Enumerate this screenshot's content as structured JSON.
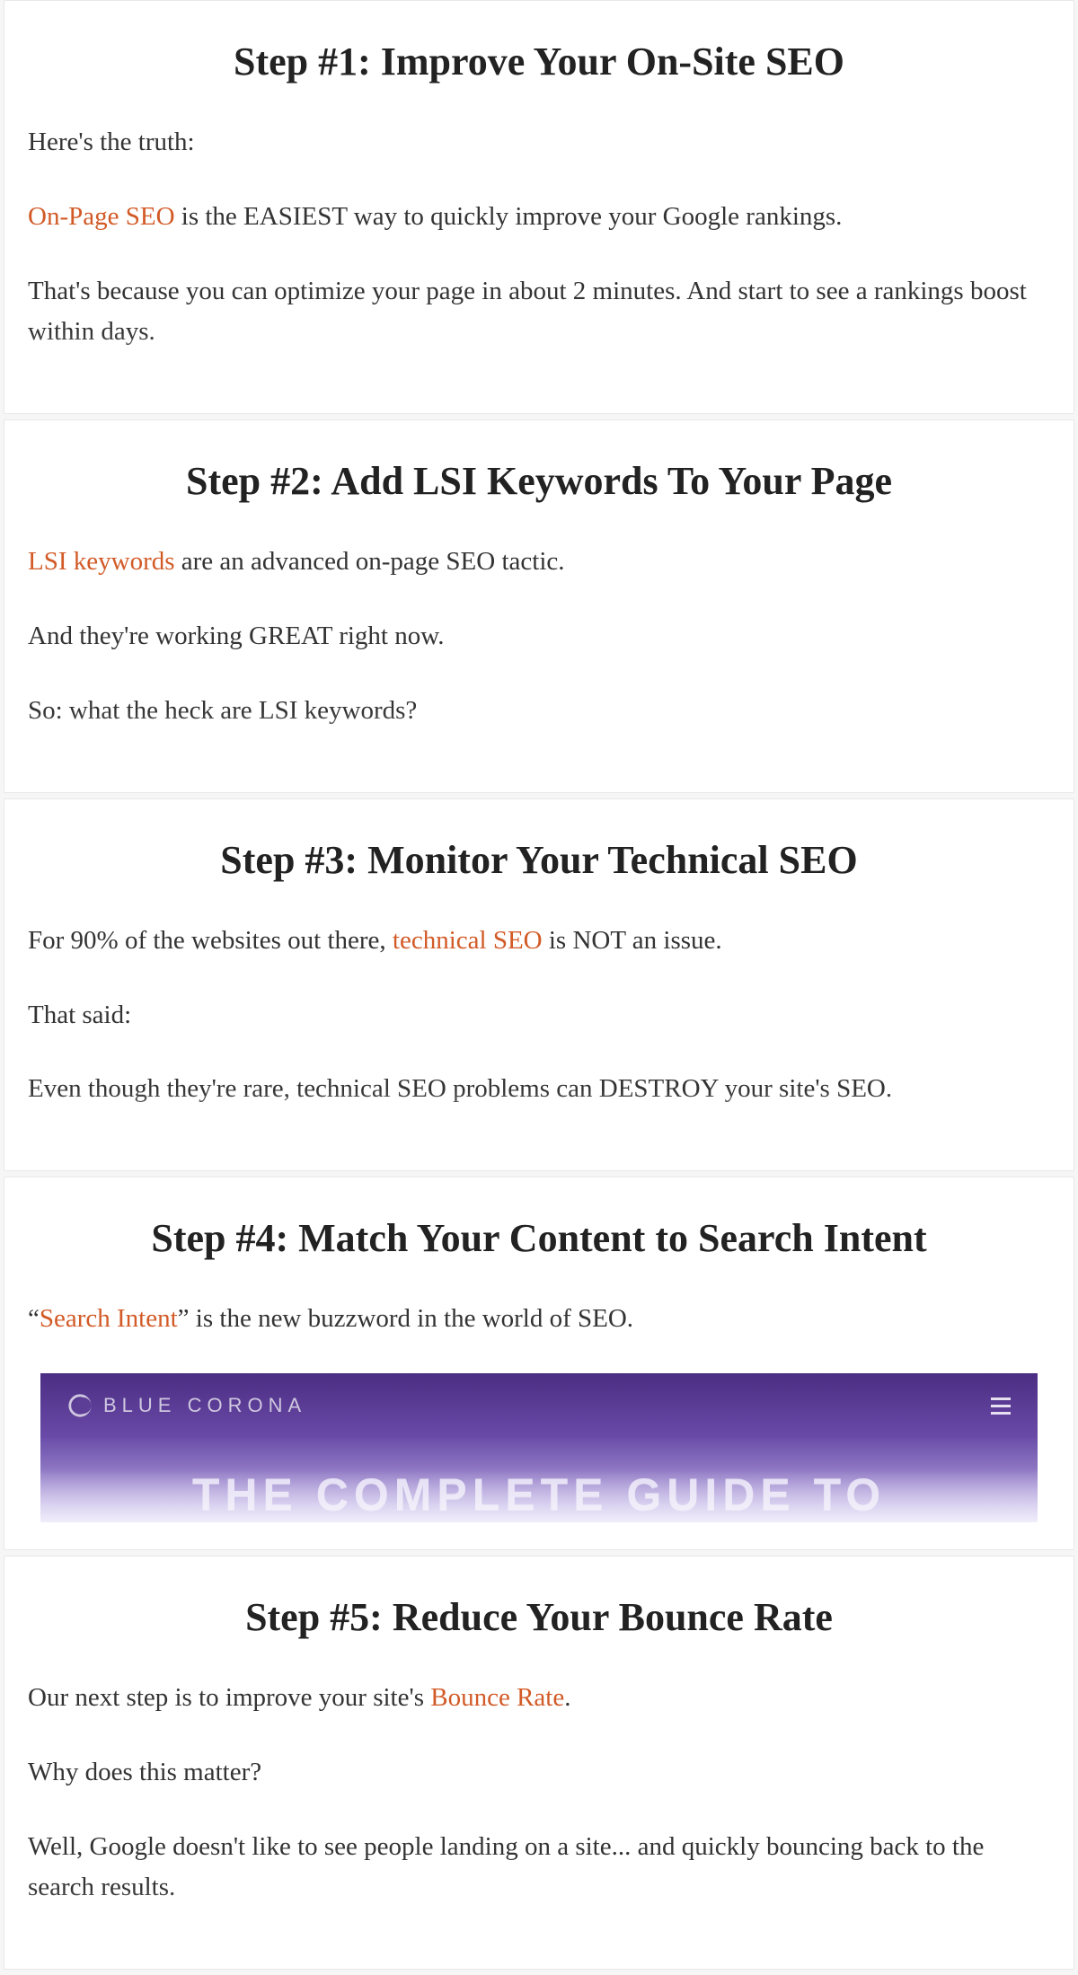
{
  "steps": [
    {
      "title": "Step #1: Improve Your On-Site SEO",
      "p1a": "Here's the truth:",
      "link1": "On-Page SEO",
      "p2rest": " is the EASIEST way to quickly improve your Google rankings.",
      "p3": "That's because you can optimize your page in about 2 minutes. And start to see a rankings boost within days."
    },
    {
      "title": "Step #2: Add LSI Keywords To Your Page",
      "link1": "LSI keywords",
      "p1rest": " are an advanced on-page SEO tactic.",
      "p2": "And they're working GREAT right now.",
      "p3": "So: what the heck are LSI keywords?"
    },
    {
      "title": "Step #3: Monitor Your Technical SEO",
      "p1a": "For 90% of the websites out there, ",
      "link1": "technical SEO",
      "p1rest": " is NOT an issue.",
      "p2": "That said:",
      "p3": "Even though they're rare, technical SEO problems can DESTROY your site's SEO."
    },
    {
      "title": "Step #4: Match Your Content to Search Intent",
      "p1a": "“",
      "link1": "Search Intent",
      "p1rest": "” is the new buzzword in the world of SEO.",
      "embed": {
        "logo_text": "BLUE CORONA",
        "body_text": "THE COMPLETE GUIDE TO"
      }
    },
    {
      "title": "Step #5: Reduce Your Bounce Rate",
      "p1a": "Our next step is to improve your site's ",
      "link1": "Bounce Rate",
      "p1rest": ".",
      "p2": "Why does this matter?",
      "p3": "Well, Google doesn't like to see people landing on a site... and quickly bouncing back to the search results."
    }
  ]
}
